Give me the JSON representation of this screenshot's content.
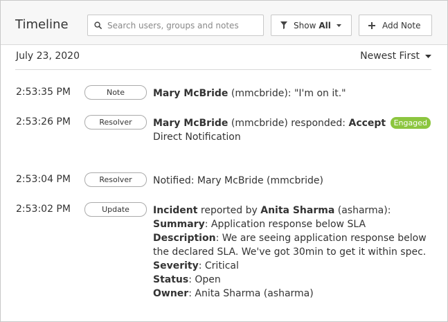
{
  "header": {
    "title": "Timeline",
    "search_placeholder": "Search users, groups and notes",
    "show_label": "Show",
    "show_value": "All",
    "add_note_label": "Add Note"
  },
  "date_header": {
    "date": "July 23, 2020",
    "sort_label": "Newest First"
  },
  "entries": [
    {
      "time": "2:53:35 PM",
      "tag": "Note",
      "user": "Mary McBride",
      "text": " (mmcbride): \"I'm on it.\""
    },
    {
      "time": "2:53:26 PM",
      "tag": "Resolver",
      "user": "Mary McBride",
      "text": " (mmcbride) responded: ",
      "action": "Accept",
      "badge": "Engaged",
      "line2": "Direct Notification"
    },
    {
      "time": "2:53:04 PM",
      "tag": "Resolver",
      "text": "Notified: Mary McBride (mmcbride)"
    },
    {
      "time": "2:53:02 PM",
      "tag": "Update",
      "incident_label": "Incident",
      "reported_by": " reported by ",
      "reporter": "Anita Sharma",
      "reporter_handle": " (asharma):",
      "summary_label": "Summary",
      "summary": ": Application response below SLA",
      "description_label": "Description",
      "description": ": We are seeing application response below the declared SLA. We've got 30min to get it within spec.",
      "severity_label": "Severity",
      "severity": ": Critical",
      "status_label": "Status",
      "status": ": Open",
      "owner_label": "Owner",
      "owner": ": Anita Sharma (asharma)"
    }
  ]
}
